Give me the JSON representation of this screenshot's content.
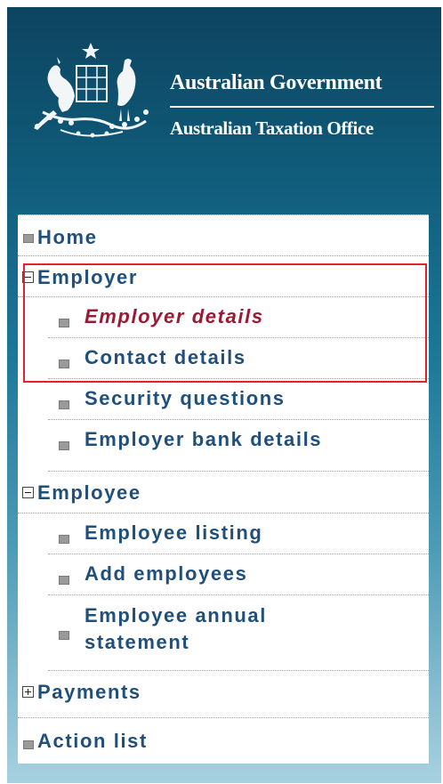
{
  "header": {
    "government": "Australian Government",
    "agency": "Australian Taxation Office"
  },
  "menu": {
    "home": "Home",
    "employer": {
      "label": "Employer",
      "items": [
        "Employer details",
        "Contact details",
        "Security questions",
        "Employer bank details"
      ]
    },
    "employee": {
      "label": "Employee",
      "items": [
        "Employee listing",
        "Add employees"
      ],
      "annual_line1": "Employee annual",
      "annual_line2": "statement"
    },
    "payments": "Payments",
    "action_list": "Action list"
  },
  "colors": {
    "header_dark": "#0d4460",
    "link": "#1f4f7a",
    "active": "#9a1a34",
    "highlight_border": "#e0232e"
  },
  "icons": [
    "coat-of-arms-logo",
    "bullet-square-icon",
    "collapse-minus-icon",
    "expand-plus-icon"
  ]
}
